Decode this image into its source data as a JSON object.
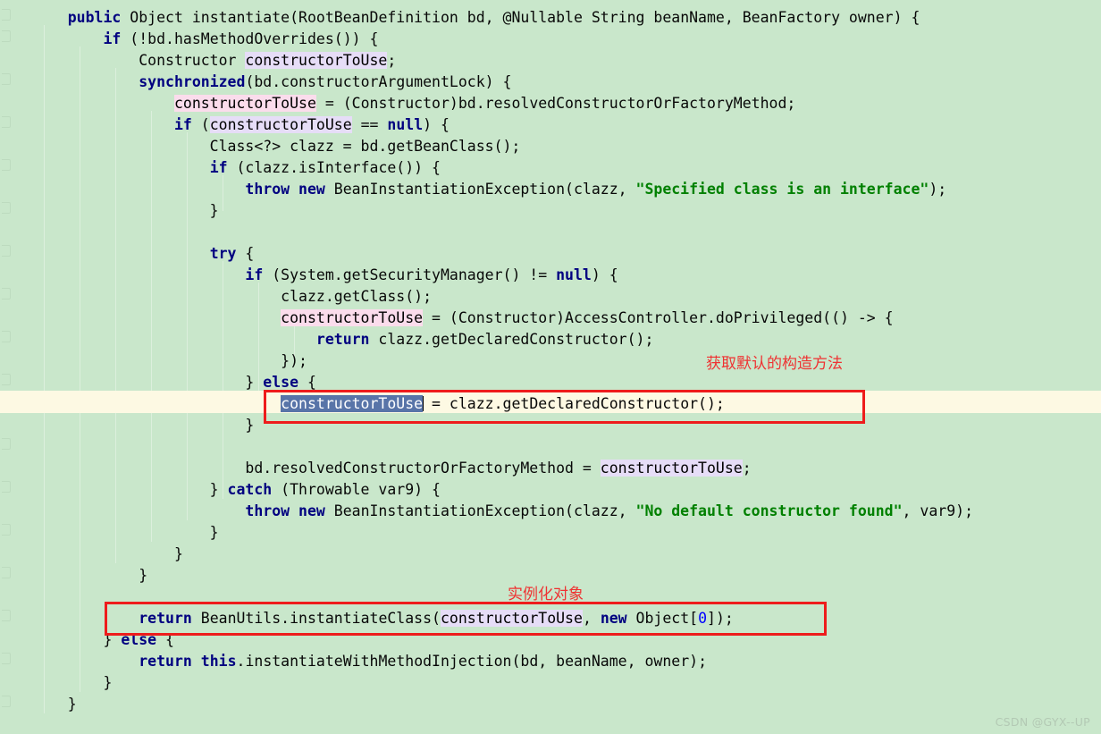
{
  "editor": {
    "background_color": "#c9e7cb",
    "caret_line_color": "#fdf9e3",
    "keyword_color": "#000080",
    "string_color": "#008000",
    "number_color": "#0000ff",
    "text_color": "#080808",
    "occurrence_read_color": "#e6ddf7",
    "occurrence_write_color": "#fbdcec",
    "selection_color": "#5874a8",
    "annotation_color": "#ef3232",
    "box_color": "#ee1c1c",
    "caret_line_number": 19,
    "gutter": {
      "bulb_icon": "lightbulb-icon",
      "bulb_color": "#f5a623"
    }
  },
  "code_lines": [
    {
      "indent": 4,
      "text": "public Object instantiate(RootBeanDefinition bd, @Nullable String beanName, BeanFactory owner) {"
    },
    {
      "indent": 8,
      "text": "if (!bd.hasMethodOverrides()) {"
    },
    {
      "indent": 12,
      "text": "Constructor constructorToUse;"
    },
    {
      "indent": 12,
      "text": "synchronized(bd.constructorArgumentLock) {"
    },
    {
      "indent": 16,
      "text": "constructorToUse = (Constructor)bd.resolvedConstructorOrFactoryMethod;"
    },
    {
      "indent": 16,
      "text": "if (constructorToUse == null) {"
    },
    {
      "indent": 20,
      "text": "Class<?> clazz = bd.getBeanClass();"
    },
    {
      "indent": 20,
      "text": "if (clazz.isInterface()) {"
    },
    {
      "indent": 24,
      "text": "throw new BeanInstantiationException(clazz, \"Specified class is an interface\");"
    },
    {
      "indent": 20,
      "text": "}"
    },
    {
      "indent": 0,
      "text": ""
    },
    {
      "indent": 20,
      "text": "try {"
    },
    {
      "indent": 24,
      "text": "if (System.getSecurityManager() != null) {"
    },
    {
      "indent": 28,
      "text": "clazz.getClass();"
    },
    {
      "indent": 28,
      "text": "constructorToUse = (Constructor)AccessController.doPrivileged(() -> {"
    },
    {
      "indent": 32,
      "text": "return clazz.getDeclaredConstructor();"
    },
    {
      "indent": 28,
      "text": "});"
    },
    {
      "indent": 24,
      "text": "} else {"
    },
    {
      "indent": 28,
      "text": "constructorToUse = clazz.getDeclaredConstructor();"
    },
    {
      "indent": 24,
      "text": "}"
    },
    {
      "indent": 0,
      "text": ""
    },
    {
      "indent": 24,
      "text": "bd.resolvedConstructorOrFactoryMethod = constructorToUse;"
    },
    {
      "indent": 20,
      "text": "} catch (Throwable var9) {"
    },
    {
      "indent": 24,
      "text": "throw new BeanInstantiationException(clazz, \"No default constructor found\", var9);"
    },
    {
      "indent": 20,
      "text": "}"
    },
    {
      "indent": 16,
      "text": "}"
    },
    {
      "indent": 12,
      "text": "}"
    },
    {
      "indent": 0,
      "text": ""
    },
    {
      "indent": 12,
      "text": "return BeanUtils.instantiateClass(constructorToUse, new Object[0]);"
    },
    {
      "indent": 8,
      "text": "} else {"
    },
    {
      "indent": 12,
      "text": "return this.instantiateWithMethodInjection(bd, beanName, owner);"
    },
    {
      "indent": 8,
      "text": "}"
    },
    {
      "indent": 4,
      "text": "}"
    }
  ],
  "annotations": [
    {
      "id": "annot-get-default-constructor",
      "text": "获取默认的构造方法"
    },
    {
      "id": "annot-instantiate-object",
      "text": "实例化对象"
    }
  ],
  "highlight_boxes": [
    {
      "id": "redbox-caret-line",
      "target_line_text": "constructorToUse = clazz.getDeclaredConstructor();"
    },
    {
      "id": "redbox-return-line",
      "target_line_text": "return BeanUtils.instantiateClass(constructorToUse, new Object[0]);"
    }
  ],
  "selection": {
    "text": "constructorToUse"
  },
  "watermark": {
    "text": "CSDN @GYX--UP"
  }
}
